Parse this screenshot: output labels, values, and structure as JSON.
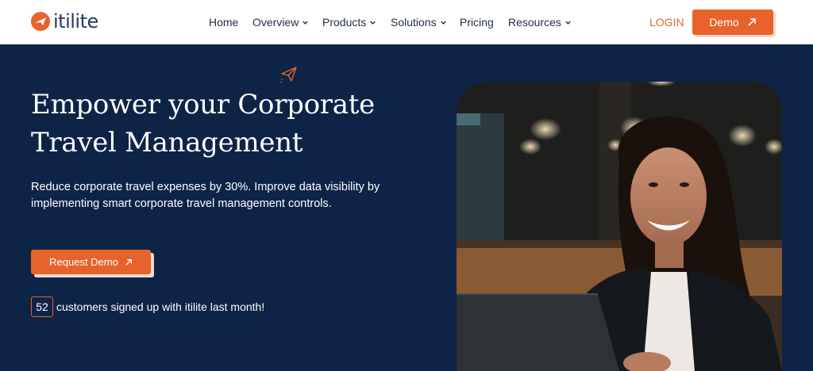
{
  "brand": {
    "name": "itilite",
    "color": "#e8622b",
    "navy": "#0d2447"
  },
  "nav": {
    "items": [
      {
        "label": "Home",
        "has_dropdown": false
      },
      {
        "label": "Overview",
        "has_dropdown": true
      },
      {
        "label": "Products",
        "has_dropdown": true
      },
      {
        "label": "Solutions",
        "has_dropdown": true
      },
      {
        "label": "Pricing",
        "has_dropdown": false
      },
      {
        "label": "Resources",
        "has_dropdown": true
      }
    ],
    "login": "LOGIN",
    "demo": "Demo"
  },
  "hero": {
    "title_line1": "Empower your Corporate",
    "title_line2": "Travel Management",
    "description": "Reduce corporate travel expenses by 30%. Improve data visibility by implementing smart corporate travel management controls.",
    "cta": "Request Demo",
    "customer_count": "52",
    "customer_text": "customers signed up with itilite last month!"
  },
  "icons": {
    "logo": "plane-logo-icon",
    "arrow": "arrow-up-right-icon",
    "chevron": "chevron-down-icon",
    "plane": "paper-plane-icon"
  }
}
